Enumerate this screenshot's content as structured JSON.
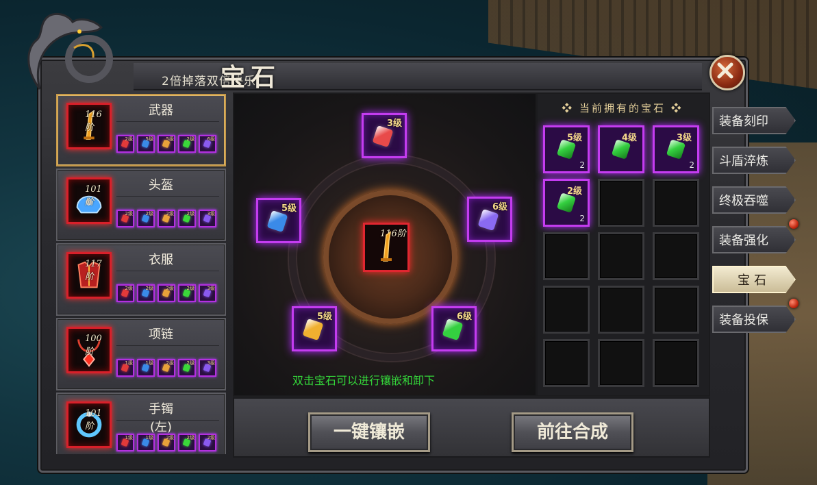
{
  "window": {
    "title": "宝石",
    "subtitle": "2倍掉落双倍快乐!"
  },
  "equipment": [
    {
      "name": "武器",
      "level": "116阶",
      "selected": true,
      "icon": "sword-icon",
      "slots": [
        {
          "lv": "2级",
          "color": "#e23a3a"
        },
        {
          "lv": "5级",
          "color": "#3a8ae8"
        },
        {
          "lv": "5级",
          "color": "#e8a23a"
        },
        {
          "lv": "2级",
          "color": "#3ad83a"
        },
        {
          "lv": "6级",
          "color": "#8a5af0"
        }
      ]
    },
    {
      "name": "头盔",
      "level": "101阶",
      "selected": false,
      "icon": "helmet-icon",
      "slots": [
        {
          "lv": "2级",
          "color": "#e23a3a"
        },
        {
          "lv": "2级",
          "color": "#3a8ae8"
        },
        {
          "lv": "2级",
          "color": "#e8a23a"
        },
        {
          "lv": "2级",
          "color": "#3ad83a"
        },
        {
          "lv": "3级",
          "color": "#8a5af0"
        }
      ]
    },
    {
      "name": "衣服",
      "level": "117阶",
      "selected": false,
      "icon": "armor-icon",
      "slots": [
        {
          "lv": "2级",
          "color": "#e23a3a"
        },
        {
          "lv": "2级",
          "color": "#3a8ae8"
        },
        {
          "lv": "2级",
          "color": "#e8a23a"
        },
        {
          "lv": "2级",
          "color": "#3ad83a"
        },
        {
          "lv": "3级",
          "color": "#8a5af0"
        }
      ]
    },
    {
      "name": "项链",
      "level": "100阶",
      "selected": false,
      "icon": "necklace-icon",
      "slots": [
        {
          "lv": "1级",
          "color": "#e23a3a"
        },
        {
          "lv": "1级",
          "color": "#3a8ae8"
        },
        {
          "lv": "2级",
          "color": "#e8a23a"
        },
        {
          "lv": "2级",
          "color": "#3ad83a"
        },
        {
          "lv": "3级",
          "color": "#8a5af0"
        }
      ]
    },
    {
      "name": "手镯(左)",
      "level": "101阶",
      "selected": false,
      "icon": "bracelet-icon",
      "slots": [
        {
          "lv": "1级",
          "color": "#e23a3a"
        },
        {
          "lv": "1级",
          "color": "#3a8ae8"
        },
        {
          "lv": "2级",
          "color": "#e8a23a"
        },
        {
          "lv": "2级",
          "color": "#3ad83a"
        },
        {
          "lv": "2级",
          "color": "#8a5af0"
        }
      ]
    }
  ],
  "center": {
    "item_level": "116阶",
    "item_icon": "sword-icon",
    "gems": [
      {
        "pos": "top",
        "lv": "3级",
        "color": "#e84a4a"
      },
      {
        "pos": "left",
        "lv": "5级",
        "color": "#3a8ae8"
      },
      {
        "pos": "right",
        "lv": "6级",
        "color": "#8a6af2"
      },
      {
        "pos": "bottom-left",
        "lv": "5级",
        "color": "#f0b030"
      },
      {
        "pos": "bottom-right",
        "lv": "6级",
        "color": "#34d040"
      }
    ],
    "hint": "双击宝石可以进行镶嵌和卸下"
  },
  "owned": {
    "title": "当前拥有的宝石",
    "cells": [
      {
        "lv": "5级",
        "count": "2",
        "color": "#34d040"
      },
      {
        "lv": "4级",
        "count": "",
        "color": "#34d040"
      },
      {
        "lv": "3级",
        "count": "2",
        "color": "#34d040"
      },
      {
        "lv": "2级",
        "count": "2",
        "color": "#34d040"
      },
      null,
      null,
      null,
      null,
      null,
      null,
      null,
      null,
      null,
      null,
      null
    ]
  },
  "buttons": {
    "inlay_all": "一键镶嵌",
    "go_synthesize": "前往合成"
  },
  "tabs": [
    {
      "label": "装备刻印",
      "active": false,
      "dot": false
    },
    {
      "label": "斗盾淬炼",
      "active": false,
      "dot": false
    },
    {
      "label": "终极吞噬",
      "active": false,
      "dot": false
    },
    {
      "label": "装备强化",
      "active": false,
      "dot": true
    },
    {
      "label": "宝石",
      "active": true,
      "dot": false
    },
    {
      "label": "装备投保",
      "active": false,
      "dot": true
    }
  ],
  "colors": {
    "accent_purple": "#c43cf0",
    "accent_red": "#e02630",
    "hint_green": "#34d63a",
    "selected_border": "#c79a4a"
  }
}
